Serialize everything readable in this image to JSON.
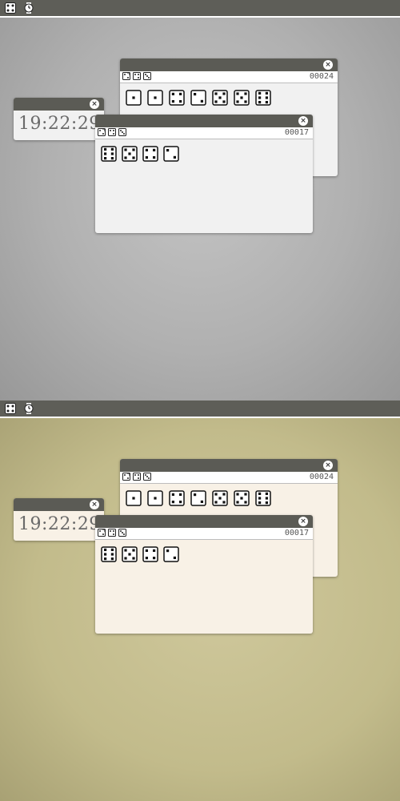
{
  "screens": [
    {
      "theme": "gray",
      "colors": {
        "desktop": "#a9a9a9",
        "window_body": "#f1f1f1",
        "clock_body": "#f1f1f1"
      },
      "topbar": {
        "icons": [
          "dice-app-icon",
          "clock-app-icon"
        ]
      },
      "clock_window": {
        "time": "19:22:29",
        "close_glyph": "×"
      },
      "dice_window_back": {
        "counter": "00024",
        "close_glyph": "×",
        "toolbar_icons": [
          "roll-all-icon",
          "add-die-icon",
          "remove-die-icon"
        ],
        "dice": [
          1,
          1,
          4,
          2,
          5,
          5,
          6
        ]
      },
      "dice_window_front": {
        "counter": "00017",
        "close_glyph": "×",
        "toolbar_icons": [
          "roll-all-icon",
          "add-die-icon",
          "remove-die-icon"
        ],
        "dice": [
          6,
          5,
          4,
          2
        ]
      }
    },
    {
      "theme": "tan",
      "colors": {
        "desktop": "#c3bc8d",
        "window_body": "#f8f1e6",
        "clock_body": "#f8f1e6"
      },
      "topbar": {
        "icons": [
          "dice-app-icon",
          "clock-app-icon"
        ]
      },
      "clock_window": {
        "time": "19:22:29",
        "close_glyph": "×"
      },
      "dice_window_back": {
        "counter": "00024",
        "close_glyph": "×",
        "toolbar_icons": [
          "roll-all-icon",
          "add-die-icon",
          "remove-die-icon"
        ],
        "dice": [
          1,
          1,
          4,
          2,
          5,
          5,
          6
        ]
      },
      "dice_window_front": {
        "counter": "00017",
        "close_glyph": "×",
        "toolbar_icons": [
          "roll-all-icon",
          "add-die-icon",
          "remove-die-icon"
        ],
        "dice": [
          6,
          5,
          4,
          2
        ]
      }
    }
  ]
}
